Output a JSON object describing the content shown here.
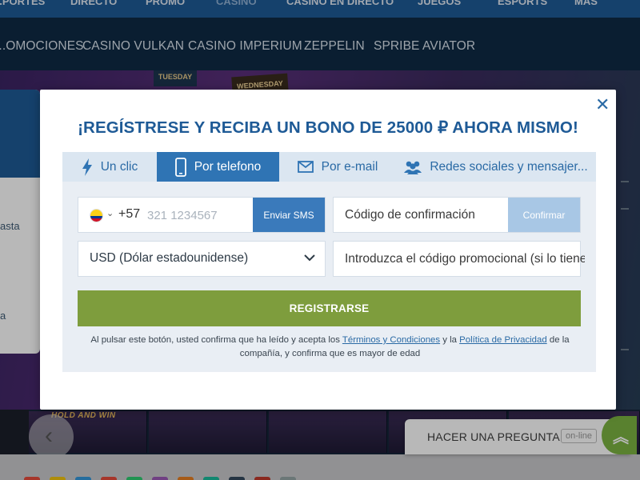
{
  "top_nav": [
    "...PORTES",
    "DIRECTO",
    "PROMO",
    "CASINO",
    "CASINO EN DIRECTO",
    "JUEGOS",
    "ESPORTS",
    "MÁS"
  ],
  "sub_nav": [
    "...OMOCIONES",
    "CASINO VULKAN",
    "CASINO IMPERIUM",
    "ZEPPELIN",
    "SPRIBE AVIATOR"
  ],
  "banner": {
    "tag1": "TUESDAY",
    "tag2": "WEDNESDAY"
  },
  "left_panel": {
    "label1": "asta",
    "label2": "a"
  },
  "games": {
    "hold_label": "HOLD AND WIN"
  },
  "modal": {
    "title": "¡REGÍSTRESE Y RECIBA UN BONO DE 25000 ₽ AHORA MISMO!",
    "close": "✕",
    "tabs": [
      {
        "label": "Un clic",
        "icon": "lightning-icon"
      },
      {
        "label": "Por telefono",
        "icon": "phone-icon",
        "active": true
      },
      {
        "label": "Por e-mail",
        "icon": "envelope-icon"
      },
      {
        "label": "Redes sociales y mensajer...",
        "icon": "users-icon"
      }
    ],
    "phone": {
      "country_code": "+57",
      "placeholder": "321 1234567",
      "send_sms": "Enviar SMS"
    },
    "confirmation": {
      "placeholder": "Código de confirmación",
      "button": "Confirmar"
    },
    "currency": {
      "value": "USD (Dólar estadounidense)"
    },
    "promo": {
      "placeholder": "Introduzca el código promocional (si lo tiene)"
    },
    "register_button": "REGISTRARSE",
    "terms": {
      "part1": "Al pulsar este botón, usted confirma que ha leído y acepta los ",
      "link1": "Términos y Condiciones",
      "part2": " y la ",
      "link2": "Política de Privacidad",
      "part3": " de la compañía, y confirma que es mayor de edad"
    }
  },
  "chat": {
    "label": "HACER UNA PREGUNTA",
    "status": "on-line"
  },
  "colors": {
    "primary": "#2f74b4",
    "register": "#7e9d3d",
    "title": "#1e5a96"
  }
}
